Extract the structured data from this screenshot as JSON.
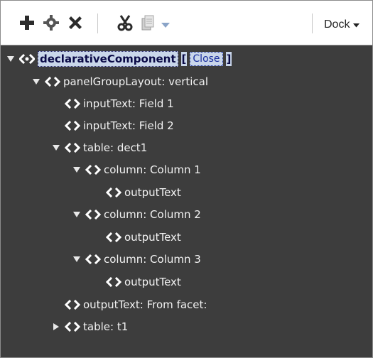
{
  "toolbar": {
    "icons": [
      "add-icon",
      "settings-icon",
      "delete-icon",
      "cut-icon",
      "copy-icon",
      "dropdown-arrow-icon"
    ],
    "dock_label": "Dock"
  },
  "tree": {
    "root": {
      "label": "declarativeComponent",
      "open_bracket": "[",
      "close_link": "Close",
      "close_bracket": "]"
    },
    "nodes": [
      {
        "label": "panelGroupLayout: vertical",
        "expanded": true
      },
      {
        "label": "inputText: Field 1"
      },
      {
        "label": "inputText: Field 2"
      },
      {
        "label": "table: dect1",
        "expanded": true
      },
      {
        "label": "column: Column 1",
        "expanded": true
      },
      {
        "label": "outputText"
      },
      {
        "label": "column: Column 2",
        "expanded": true
      },
      {
        "label": "outputText"
      },
      {
        "label": "column: Column 3",
        "expanded": true
      },
      {
        "label": "outputText"
      },
      {
        "label": "outputText: From facet:"
      },
      {
        "label": "table: t1",
        "expanded": false
      }
    ]
  },
  "colors": {
    "panel_bg": "#3d3d3d",
    "toolbar_bg": "#ffffff",
    "text": "#f2f2f2",
    "selection_bg": "#c9d6ea"
  }
}
